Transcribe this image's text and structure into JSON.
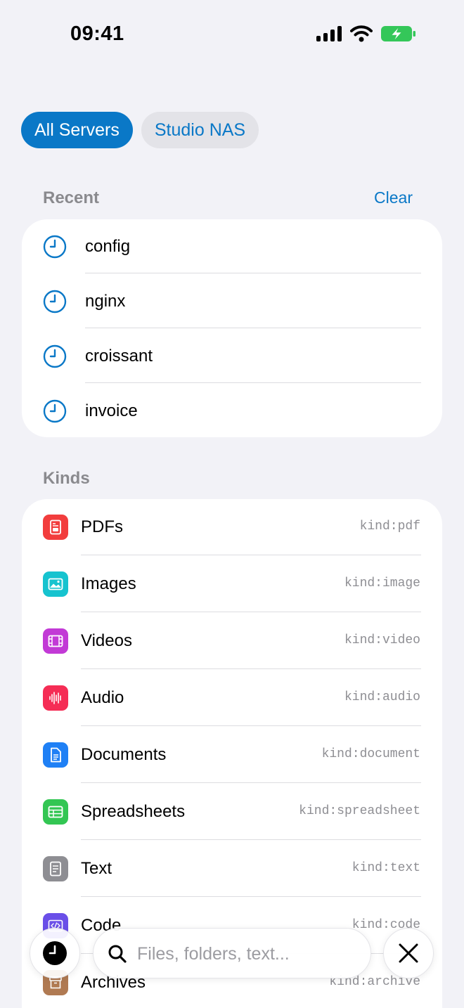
{
  "status": {
    "time": "09:41"
  },
  "filters": {
    "all_servers": "All Servers",
    "studio_nas": "Studio NAS"
  },
  "recent": {
    "title": "Recent",
    "clear": "Clear",
    "items": [
      {
        "label": "config"
      },
      {
        "label": "nginx"
      },
      {
        "label": "croissant"
      },
      {
        "label": "invoice"
      }
    ]
  },
  "kinds": {
    "title": "Kinds",
    "items": [
      {
        "label": "PDFs",
        "value": "kind:pdf",
        "icon": "pdf-icon",
        "color": "#f23d3d"
      },
      {
        "label": "Images",
        "value": "kind:image",
        "icon": "image-icon",
        "color": "#16c3cf"
      },
      {
        "label": "Videos",
        "value": "kind:video",
        "icon": "film-icon",
        "color": "#c23ad6"
      },
      {
        "label": "Audio",
        "value": "kind:audio",
        "icon": "waveform-icon",
        "color": "#f52d55"
      },
      {
        "label": "Documents",
        "value": "kind:document",
        "icon": "document-icon",
        "color": "#1f80f5"
      },
      {
        "label": "Spreadsheets",
        "value": "kind:spreadsheet",
        "icon": "table-icon",
        "color": "#33c653"
      },
      {
        "label": "Text",
        "value": "kind:text",
        "icon": "text-icon",
        "color": "#8e8e93"
      },
      {
        "label": "Code",
        "value": "kind:code",
        "icon": "code-icon",
        "color": "#6a4fe8"
      },
      {
        "label": "Archives",
        "value": "kind:archive",
        "icon": "archive-icon",
        "color": "#b07a52"
      }
    ]
  },
  "search": {
    "placeholder": "Files, folders, text..."
  },
  "colors": {
    "accent": "#0a78c7",
    "background": "#f2f2f7",
    "battery": "#34c759"
  }
}
